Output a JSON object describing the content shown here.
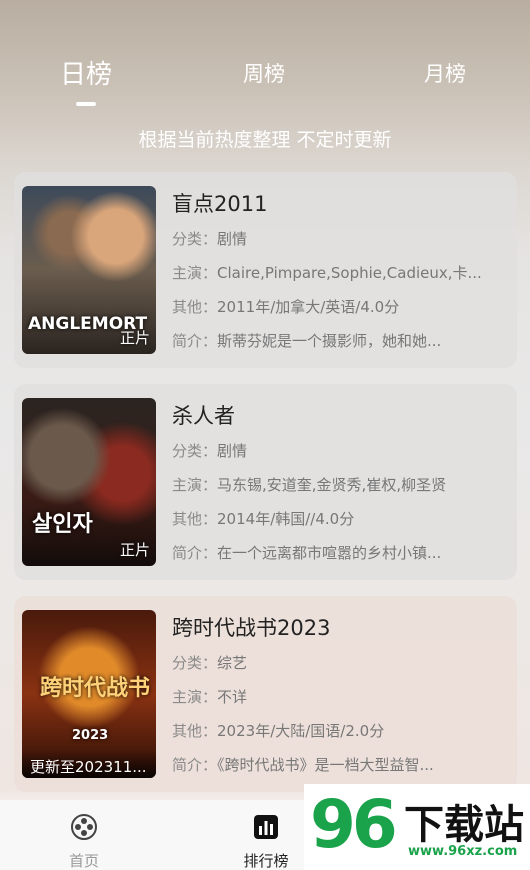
{
  "tabs": [
    {
      "label": "日榜",
      "active": true
    },
    {
      "label": "周榜",
      "active": false
    },
    {
      "label": "月榜",
      "active": false
    }
  ],
  "subtitle": "根据当前热度整理 不定时更新",
  "labels": {
    "category": "分类：",
    "cast": "主演：",
    "other": "其他：",
    "intro": "简介："
  },
  "items": [
    {
      "title": "盲点2011",
      "category": "剧情",
      "cast": "Claire,Pimpare,Sophie,Cadieux,卡...",
      "other": "2011年/加拿大/英语/4.0分",
      "intro": "斯蒂芬妮是一个摄影师，她和她...",
      "badge": "正片",
      "poster_text": "ANGLEMORT"
    },
    {
      "title": "杀人者",
      "category": "剧情",
      "cast": "马东锡,安道奎,金贤秀,崔权,柳圣贤",
      "other": "2014年/韩国//4.0分",
      "intro": "在一个远离都市喧嚣的乡村小镇...",
      "badge": "正片",
      "poster_text": "살인자"
    },
    {
      "title": "跨时代战书2023",
      "category": "综艺",
      "cast": "不详",
      "other": "2023年/大陆/国语/2.0分",
      "intro": "《跨时代战书》是一档大型益智...",
      "badge": "更新至202311...",
      "poster_text": "跨时代战书",
      "poster_year": "2023"
    }
  ],
  "nav": [
    {
      "label": "首页",
      "icon": "film-reel-icon",
      "active": false
    },
    {
      "label": "排行榜",
      "icon": "ranking-icon",
      "active": true
    }
  ],
  "watermark": {
    "number": "96",
    "text": "下载站",
    "url": "www.96xz.com"
  }
}
